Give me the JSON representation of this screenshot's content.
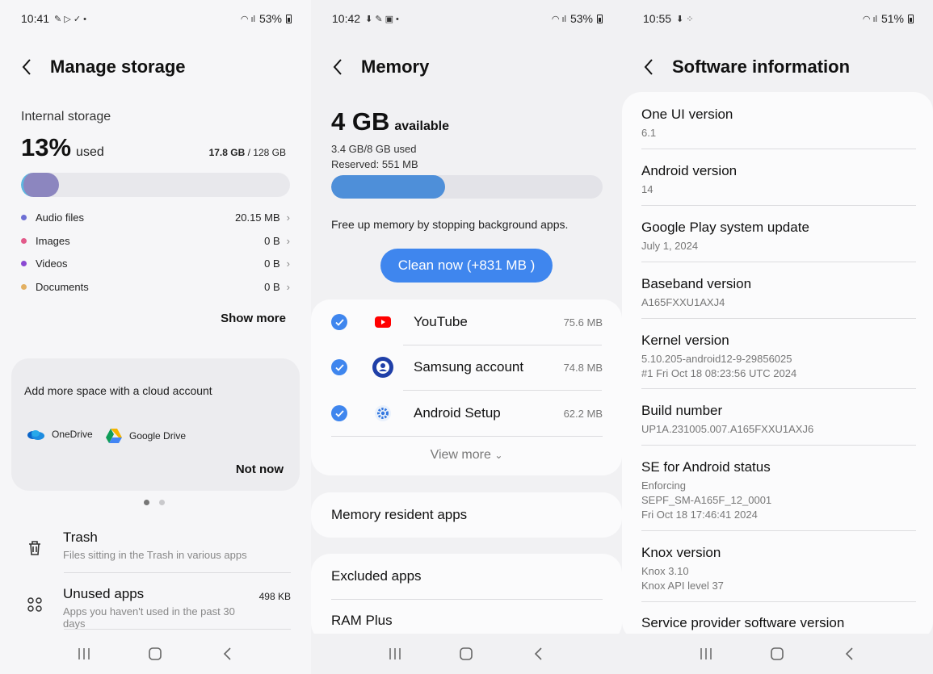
{
  "panel1": {
    "status": {
      "time": "10:41",
      "battery": "53%"
    },
    "title": "Manage storage",
    "internal_label": "Internal storage",
    "used_pct": "13%",
    "used_word": "used",
    "used_amount": "17.8 GB",
    "total_amount": "/ 128 GB",
    "bar_fraction": 0.13,
    "legend": [
      {
        "name": "Audio files",
        "value": "20.15 MB",
        "color": "#6d6fd4"
      },
      {
        "name": "Images",
        "value": "0 B",
        "color": "#e25a8a"
      },
      {
        "name": "Videos",
        "value": "0 B",
        "color": "#8b49d3"
      },
      {
        "name": "Documents",
        "value": "0 B",
        "color": "#e3b062"
      }
    ],
    "show_more": "Show more",
    "cloud": {
      "title": "Add more space with a cloud account",
      "onedrive": "OneDrive",
      "gdrive": "Google Drive",
      "not_now": "Not now"
    },
    "trash": {
      "title": "Trash",
      "subtitle": "Files sitting in the Trash in various apps"
    },
    "unused": {
      "title": "Unused apps",
      "subtitle": "Apps you haven't used in the past 30 days",
      "size": "498 KB"
    }
  },
  "panel2": {
    "status": {
      "time": "10:42",
      "battery": "53%"
    },
    "title": "Memory",
    "available_big": "4 GB",
    "available_word": "available",
    "used_line": "3.4 GB/8 GB used",
    "reserved_line": "Reserved: 551 MB",
    "bar_fraction": 0.42,
    "free_text": "Free up memory by stopping background apps.",
    "clean_button": "Clean now (+831 MB )",
    "apps": [
      {
        "name": "YouTube",
        "size": "75.6 MB",
        "icon": "youtube-icon"
      },
      {
        "name": "Samsung account",
        "size": "74.8 MB",
        "icon": "samsung-account-icon"
      },
      {
        "name": "Android Setup",
        "size": "62.2 MB",
        "icon": "gear-icon"
      }
    ],
    "view_more": "View more",
    "memory_resident": "Memory resident apps",
    "excluded": "Excluded apps",
    "ram_plus": "RAM Plus"
  },
  "panel3": {
    "status": {
      "time": "10:55",
      "battery": "51%"
    },
    "title": "Software information",
    "items": [
      {
        "key": "One UI version",
        "lines": [
          "6.1"
        ]
      },
      {
        "key": "Android version",
        "lines": [
          "14"
        ]
      },
      {
        "key": "Google Play system update",
        "lines": [
          "July 1, 2024"
        ]
      },
      {
        "key": "Baseband version",
        "lines": [
          "A165FXXU1AXJ4"
        ]
      },
      {
        "key": "Kernel version",
        "lines": [
          "5.10.205-android12-9-29856025",
          "#1 Fri Oct 18 08:23:56 UTC 2024"
        ]
      },
      {
        "key": "Build number",
        "lines": [
          "UP1A.231005.007.A165FXXU1AXJ6"
        ]
      },
      {
        "key": "SE for Android status",
        "lines": [
          "Enforcing",
          "SEPF_SM-A165F_12_0001",
          "Fri Oct 18 17:46:41 2024"
        ]
      },
      {
        "key": "Knox version",
        "lines": [
          "Knox 3.10",
          "Knox API level 37"
        ]
      },
      {
        "key": "Service provider software version",
        "lines": []
      }
    ]
  }
}
